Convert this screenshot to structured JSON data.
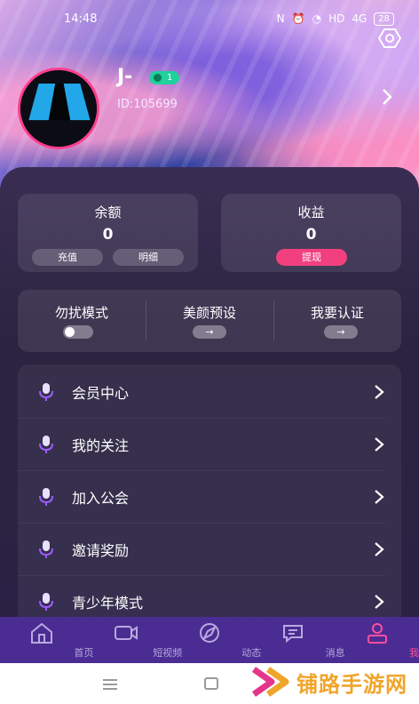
{
  "status": {
    "time": "14:48",
    "nfc": "N",
    "network": "4G",
    "hd": "HD",
    "battery": "28"
  },
  "profile": {
    "username": "J-",
    "level": "1",
    "id_text": "ID:105699"
  },
  "balance": {
    "title": "余额",
    "value": "0",
    "recharge_label": "充值",
    "detail_label": "明细"
  },
  "income": {
    "title": "收益",
    "value": "0",
    "withdraw_label": "提现"
  },
  "quick": {
    "dnd_label": "勿扰模式",
    "beauty_label": "美颜预设",
    "verify_label": "我要认证",
    "arrow": "→"
  },
  "menu": {
    "items": [
      {
        "label": "会员中心"
      },
      {
        "label": "我的关注"
      },
      {
        "label": "加入公会"
      },
      {
        "label": "邀请奖励"
      },
      {
        "label": "青少年模式"
      }
    ]
  },
  "tabs": [
    {
      "label": "首页"
    },
    {
      "label": "短视频"
    },
    {
      "label": "动态"
    },
    {
      "label": "消息"
    },
    {
      "label": "我的"
    }
  ],
  "watermark": {
    "text": "铺路手游网"
  },
  "colors": {
    "accent_pink": "#f2407f",
    "tabbar": "#4b2c92",
    "level_green": "#1fd19a",
    "watermark_orange": "#f0a42a"
  }
}
